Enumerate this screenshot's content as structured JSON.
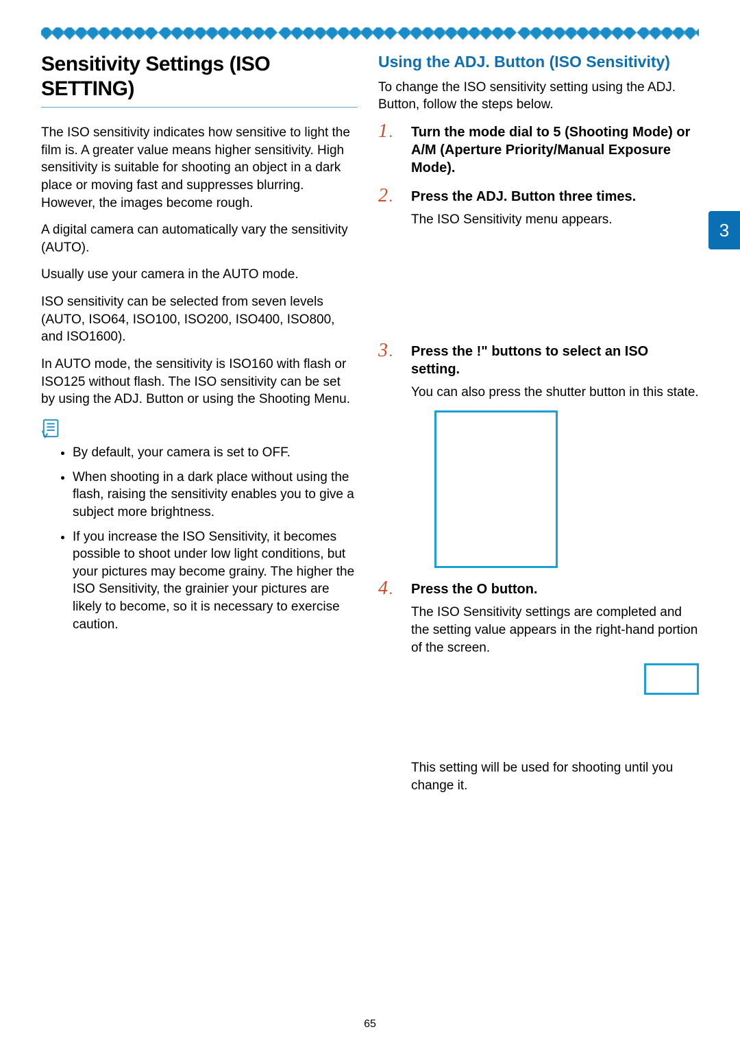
{
  "page_number": "65",
  "tab_number": "3",
  "left": {
    "title": "Sensitivity Settings (ISO SETTING)",
    "p1": "The ISO sensitivity indicates how sensitive to light the film is. A greater value means higher sensitivity. High sensitivity is suitable for shooting an object in a dark place or moving fast and suppresses blurring. However, the images become rough.",
    "p2": "A digital camera can automatically vary the sensitivity (AUTO).",
    "p3": "Usually use your camera in the AUTO mode.",
    "p4": "ISO sensitivity can be selected from seven levels (AUTO, ISO64, ISO100, ISO200, ISO400, ISO800, and ISO1600).",
    "p5": "In AUTO mode, the sensitivity is ISO160 with flash or ISO125 without flash. The ISO sensitivity can be set by using the ADJ. Button or using the Shooting Menu.",
    "bullets": [
      "By default, your camera is set to OFF.",
      "When shooting in a dark place without using the flash, raising the sensitivity enables you to give a subject more brightness.",
      "If you increase the ISO Sensitivity, it becomes possible to shoot under low light conditions, but your pictures may become grainy. The higher the ISO Sensitivity, the grainier your pictures are likely to become, so it is necessary to exercise caution."
    ]
  },
  "right": {
    "subhead": "Using the ADJ. Button (ISO Sensitivity)",
    "intro": "To change the ISO sensitivity setting using the ADJ. Button, follow the steps below.",
    "steps": [
      {
        "num": "1",
        "title_pre": "Turn the mode dial to ",
        "glyph1": "5",
        "title_mid": " (Shooting Mode) or A/M (Aperture Priority/Manual Exposure Mode).",
        "body": ""
      },
      {
        "num": "2",
        "title_pre": "Press the ADJ. Button three times.",
        "glyph1": "",
        "title_mid": "",
        "body": "The ISO Sensitivity menu appears."
      },
      {
        "num": "3",
        "title_pre": "Press the ",
        "glyph1": "!\"",
        "title_mid": " buttons to select an ISO setting.",
        "body": "You can also press the shutter button in this state."
      },
      {
        "num": "4",
        "title_pre": "Press the ",
        "glyph1": "O",
        "title_mid": " button.",
        "body": "The ISO Sensitivity settings are completed and the setting value appears in the right-hand portion of the screen."
      }
    ],
    "closing": "This setting will be used for shooting until you change it."
  }
}
